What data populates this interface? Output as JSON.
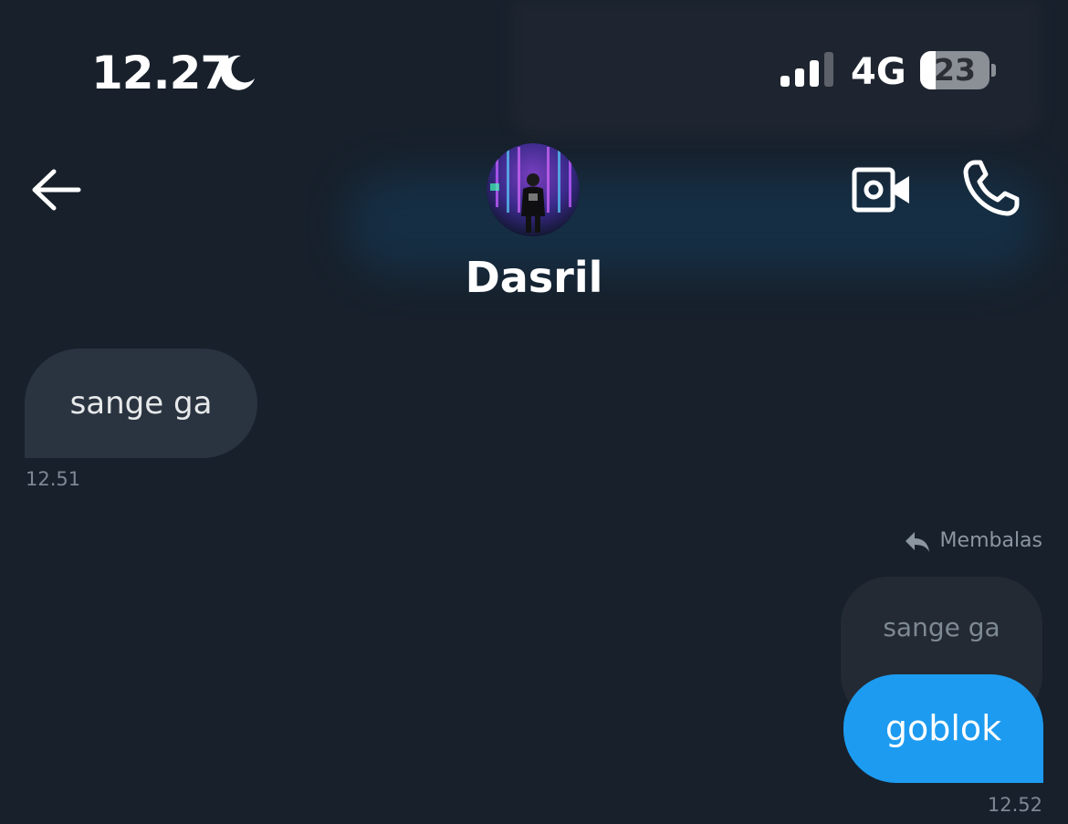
{
  "status_bar": {
    "time": "12.27",
    "network": "4G",
    "battery_level": "23",
    "battery_fraction": 0.23,
    "signal_bars_active": 3,
    "signal_bars_total": 4,
    "icons": [
      "moon-icon",
      "signal-icon",
      "battery-icon"
    ]
  },
  "header": {
    "contact_name": "Dasril",
    "icons": [
      "back-arrow-icon",
      "video-call-icon",
      "phone-icon"
    ]
  },
  "messages": {
    "incoming": {
      "text": "sange ga",
      "time": "12.51"
    },
    "outgoing": {
      "reply_label": "Membalas",
      "quoted_text": "sange ga",
      "text": "goblok",
      "time": "12.52"
    }
  },
  "colors": {
    "background": "#17202b",
    "incoming_bubble": "#2a3440",
    "outgoing_bubble": "#1d9bf0",
    "quoted_bubble": "#232a34",
    "muted_text": "#7d8894"
  }
}
